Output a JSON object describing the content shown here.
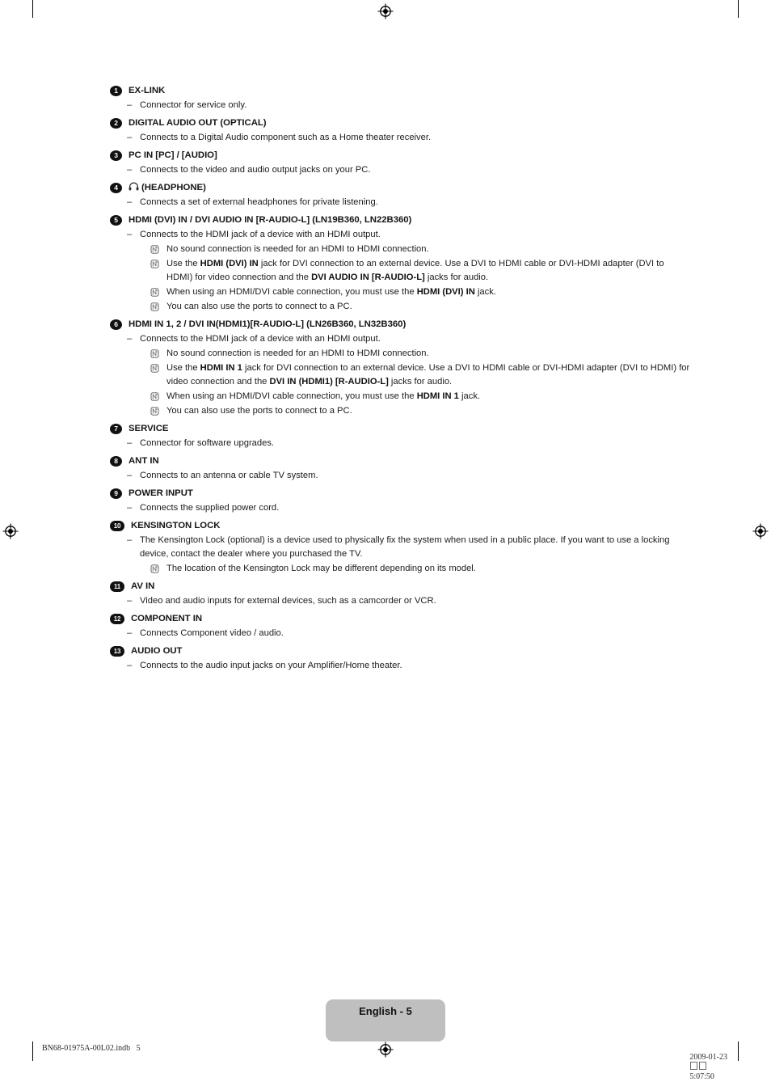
{
  "document": {
    "page_label": "English - 5",
    "footer_left": "BN68-01975A-00L02.indb   5",
    "footer_right_date": "2009-01-23",
    "footer_right_time": "5:07:50"
  },
  "entries": [
    {
      "number": "1",
      "title": "EX-LINK",
      "lines": [
        {
          "type": "dash",
          "text": "Connector for service only."
        }
      ]
    },
    {
      "number": "2",
      "title": "DIGITAL AUDIO OUT (OPTICAL)",
      "lines": [
        {
          "type": "dash",
          "text": "Connects to a Digital Audio component such as a Home theater receiver."
        }
      ]
    },
    {
      "number": "3",
      "title": "PC IN [PC] / [AUDIO]",
      "lines": [
        {
          "type": "dash",
          "text": "Connects to the video and audio output jacks on your PC."
        }
      ]
    },
    {
      "number": "4",
      "title": "(HEADPHONE)",
      "icon": "headphone-icon",
      "lines": [
        {
          "type": "dash",
          "text": "Connects a set of external headphones for private listening."
        }
      ]
    },
    {
      "number": "5",
      "title": "HDMI (DVI) IN / DVI AUDIO IN [R-AUDIO-L] (LN19B360, LN22B360)",
      "lines": [
        {
          "type": "dash",
          "text": "Connects to the HDMI jack of a device with an HDMI output."
        },
        {
          "type": "note",
          "html": "No sound connection is needed for an HDMI to HDMI connection."
        },
        {
          "type": "note",
          "html": "Use the <b>HDMI (DVI) IN</b> jack for DVI connection to an external device. Use a DVI to HDMI cable or DVI-HDMI adapter (DVI to HDMI) for video connection and the <b>DVI AUDIO IN [R-AUDIO-L]</b> jacks for audio."
        },
        {
          "type": "note",
          "html": "When using an HDMI/DVI cable connection, you must use the <b>HDMI (DVI) IN</b> jack."
        },
        {
          "type": "note",
          "html": "You can also use the ports to connect to a PC."
        }
      ]
    },
    {
      "number": "6",
      "title": "HDMI IN 1, 2 / DVI IN(HDMI1)[R-AUDIO-L] (LN26B360, LN32B360)",
      "lines": [
        {
          "type": "dash",
          "text": "Connects to the HDMI jack of a device with an HDMI output."
        },
        {
          "type": "note",
          "html": "No sound connection is needed for an HDMI to HDMI connection."
        },
        {
          "type": "note",
          "html": "Use the <b>HDMI IN 1</b> jack for DVI connection to an external device. Use a DVI to HDMI cable or DVI-HDMI adapter (DVI to HDMI) for video connection and the <b>DVI IN (HDMI1) [R-AUDIO-L]</b> jacks for audio."
        },
        {
          "type": "note",
          "html": "When using an HDMI/DVI cable connection, you must use the <b>HDMI IN 1</b> jack."
        },
        {
          "type": "note",
          "html": "You can also use the ports to connect to a PC."
        }
      ]
    },
    {
      "number": "7",
      "title": "SERVICE",
      "lines": [
        {
          "type": "dash",
          "text": "Connector for software upgrades."
        }
      ]
    },
    {
      "number": "8",
      "title": "ANT IN",
      "lines": [
        {
          "type": "dash",
          "text": "Connects to an antenna or cable TV system."
        }
      ]
    },
    {
      "number": "9",
      "title": "POWER INPUT",
      "lines": [
        {
          "type": "dash",
          "text": "Connects the supplied power cord."
        }
      ]
    },
    {
      "number": "10",
      "title": "KENSINGTON LOCK",
      "lines": [
        {
          "type": "dash",
          "text": "The Kensington Lock (optional) is a device used to physically fix the system when used in a public place. If you want to use a locking device, contact the dealer where you purchased the TV."
        },
        {
          "type": "note",
          "html": "The location of the Kensington Lock may be different depending on its model."
        }
      ]
    },
    {
      "number": "11",
      "title": "AV IN",
      "lines": [
        {
          "type": "dash",
          "text": "Video and audio inputs for external devices, such as a camcorder or VCR."
        }
      ]
    },
    {
      "number": "12",
      "title": "COMPONENT IN",
      "lines": [
        {
          "type": "dash",
          "text": "Connects Component video / audio."
        }
      ]
    },
    {
      "number": "13",
      "title": "AUDIO OUT",
      "lines": [
        {
          "type": "dash",
          "text": "Connects to the audio input jacks on your Amplifier/Home theater."
        }
      ]
    }
  ]
}
